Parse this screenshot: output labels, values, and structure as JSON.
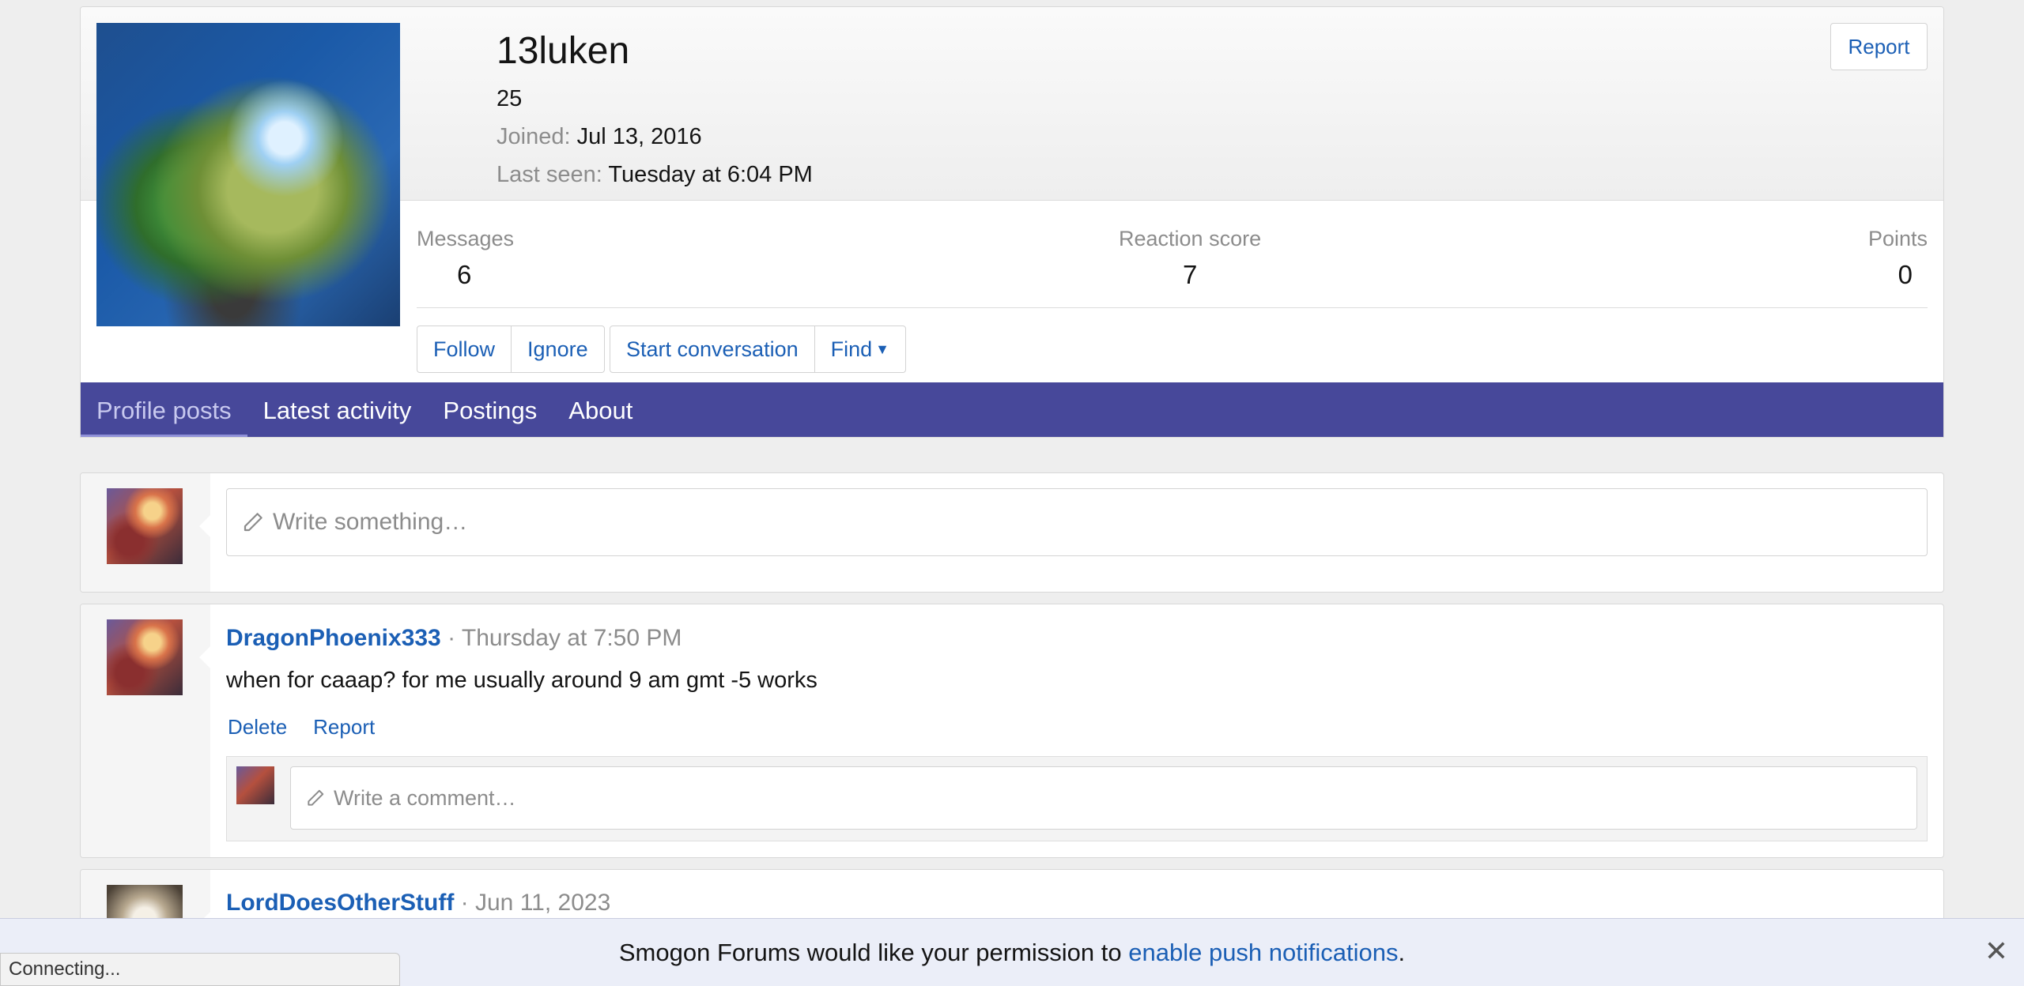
{
  "profile": {
    "username": "13luken",
    "title": "25",
    "joined_label": "Joined:",
    "joined_value": "Jul 13, 2016",
    "lastseen_label": "Last seen:",
    "lastseen_value": "Tuesday at 6:04 PM",
    "report_label": "Report",
    "stats": {
      "messages_label": "Messages",
      "messages_value": "6",
      "reaction_label": "Reaction score",
      "reaction_value": "7",
      "points_label": "Points",
      "points_value": "0"
    },
    "buttons": {
      "follow": "Follow",
      "ignore": "Ignore",
      "start_conversation": "Start conversation",
      "find": "Find"
    }
  },
  "tabs": [
    {
      "label": "Profile posts",
      "active": true
    },
    {
      "label": "Latest activity",
      "active": false
    },
    {
      "label": "Postings",
      "active": false
    },
    {
      "label": "About",
      "active": false
    }
  ],
  "composer": {
    "placeholder": "Write something…"
  },
  "posts": [
    {
      "author": "DragonPhoenix333",
      "time": "Thursday at 7:50 PM",
      "text": "when for caaap? for me usually around 9 am gmt -5 works",
      "actions": {
        "delete": "Delete",
        "report": "Report"
      },
      "comment_placeholder": "Write a comment…"
    },
    {
      "author": "LordDoesOtherStuff",
      "time": "Jun 11, 2023"
    }
  ],
  "push": {
    "text_before": "Smogon Forums would like your permission to ",
    "link_text": "enable push notifications",
    "text_after": ".",
    "close": "✕"
  },
  "status": {
    "text": "Connecting..."
  },
  "colors": {
    "tab_bar": "#47489a",
    "link": "#1b5fb5"
  },
  "icons": [
    "pencil-icon",
    "caret-down-icon",
    "close-icon"
  ]
}
